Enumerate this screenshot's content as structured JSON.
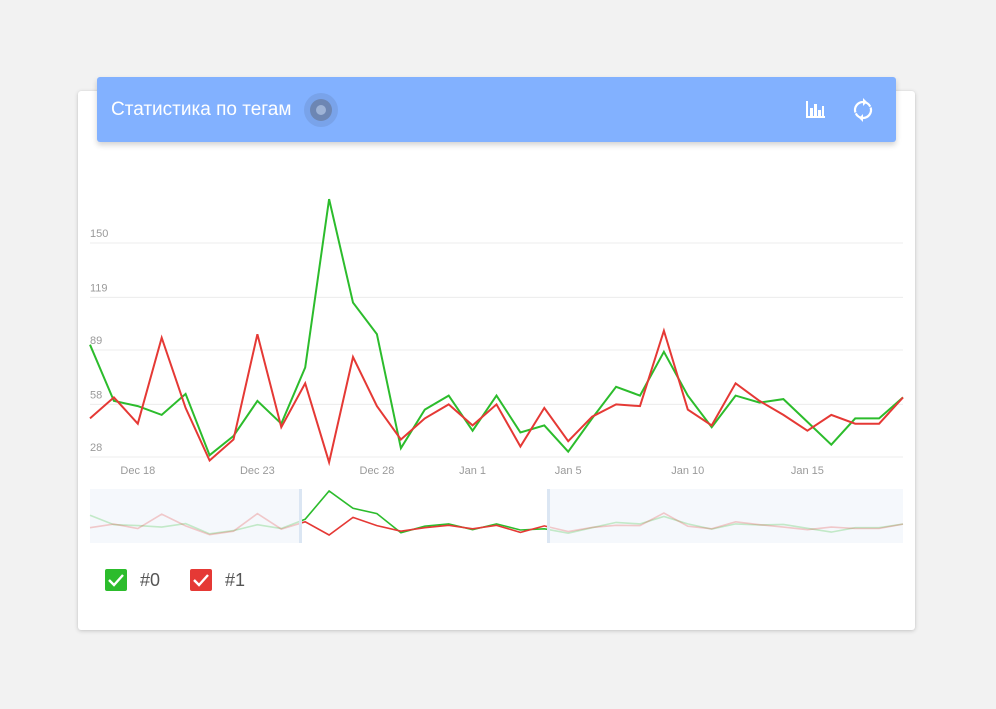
{
  "header": {
    "title": "Статистика по тегам",
    "icons": [
      "bar-chart-icon",
      "refresh-icon"
    ]
  },
  "colors": {
    "header_bg": "#82b1ff",
    "series_0": "#2cbc2c",
    "series_1": "#e53935"
  },
  "legend": [
    {
      "label": "#0",
      "checked": true,
      "color": "#2cbc2c"
    },
    {
      "label": "#1",
      "checked": true,
      "color": "#e53935"
    }
  ],
  "chart_data": {
    "type": "line",
    "title": "",
    "xlabel": "",
    "ylabel": "",
    "y_ticks": [
      "150",
      "119",
      "89",
      "58",
      "28"
    ],
    "x_ticks": [
      "Dec 18",
      "Dec 23",
      "Dec 28",
      "Jan 1",
      "Jan 5",
      "Jan 10",
      "Jan 15"
    ],
    "grid": true,
    "x": [
      "Dec 16",
      "Dec 17",
      "Dec 18",
      "Dec 19",
      "Dec 20",
      "Dec 21",
      "Dec 22",
      "Dec 23",
      "Dec 24",
      "Dec 25",
      "Dec 26",
      "Dec 27",
      "Dec 28",
      "Dec 29",
      "Dec 30",
      "Dec 31",
      "Jan 1",
      "Jan 2",
      "Jan 3",
      "Jan 4",
      "Jan 5",
      "Jan 6",
      "Jan 7",
      "Jan 8",
      "Jan 9",
      "Jan 10",
      "Jan 11",
      "Jan 12",
      "Jan 13",
      "Jan 14",
      "Jan 15",
      "Jan 16",
      "Jan 17",
      "Jan 18",
      "Jan 19"
    ],
    "series": [
      {
        "name": "#0",
        "values": [
          92,
          60,
          57,
          52,
          64,
          29,
          40,
          60,
          47,
          79,
          175,
          116,
          98,
          33,
          55,
          63,
          43,
          63,
          42,
          46,
          31,
          50,
          68,
          63,
          88,
          63,
          45,
          63,
          59,
          61,
          48,
          35,
          50,
          50,
          62
        ]
      },
      {
        "name": "#1",
        "values": [
          50,
          62,
          47,
          96,
          56,
          26,
          38,
          98,
          45,
          70,
          25,
          85,
          57,
          38,
          50,
          58,
          46,
          58,
          34,
          56,
          37,
          51,
          58,
          57,
          100,
          55,
          46,
          70,
          60,
          52,
          43,
          52,
          47,
          47,
          62
        ]
      }
    ]
  }
}
